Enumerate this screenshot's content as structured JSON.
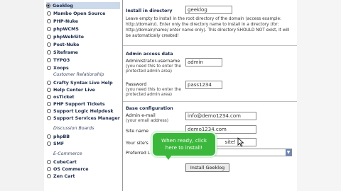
{
  "sidebar": {
    "groups": [
      {
        "items": [
          {
            "label": "Geeklog",
            "selected": true
          },
          {
            "label": "Mambo Open Source"
          },
          {
            "label": "PHP-Nuke"
          },
          {
            "label": "phpWCMS"
          },
          {
            "label": "phpWebSite"
          },
          {
            "label": "Post-Nuke"
          },
          {
            "label": "Siteframe"
          },
          {
            "label": "TYPO3"
          },
          {
            "label": "Xoops"
          }
        ]
      },
      {
        "heading": "Customer Relationship",
        "items": [
          {
            "label": "Crafty Syntax Live Help"
          },
          {
            "label": "Help Center Live"
          },
          {
            "label": "osTicket"
          },
          {
            "label": "PHP Support Tickets"
          },
          {
            "label": "Support Logic Helpdesk"
          },
          {
            "label": "Support Services Manager"
          }
        ]
      },
      {
        "heading": "Discussion Boards",
        "items": [
          {
            "label": "phpBB"
          },
          {
            "label": "SMF"
          }
        ]
      },
      {
        "heading": "E-Commerce",
        "items": [
          {
            "label": "CubeCart"
          },
          {
            "label": "OS Commerce"
          },
          {
            "label": "Zen Cart"
          }
        ]
      }
    ]
  },
  "form": {
    "install_dir": {
      "label": "Install in directory",
      "value": "geeklog",
      "hint": "Leave empty to install in the root directory of the domain (access example: http://domain/). Enter only the directory name to install in a directory (for: http://domain/name/ enter name only). This directory SHOULD NOT exist, it will be automatically created!"
    },
    "admin_section": "Admin access data",
    "admin_user": {
      "label": "Administrator-username",
      "sub": "(you need this to enter the protected admin area)",
      "value": "admin"
    },
    "admin_pass": {
      "label": "Password",
      "sub": "(you need this to enter the protected admin area)",
      "value": "pass1234"
    },
    "base_section": "Base configuration",
    "admin_email": {
      "label": "Admin e-mail",
      "sub": "(your email address)",
      "value": "info@demo1234.com"
    },
    "site_name": {
      "label": "Site name",
      "value": "demo1234.com"
    },
    "site_slogan": {
      "label": "Your site's",
      "value": "site!"
    },
    "pref_lang": {
      "label": "Preferred L"
    },
    "install_button": "Install Geeklog"
  },
  "tooltip": {
    "text": "When ready, click here to install!",
    "color": "#3bb83b"
  },
  "colors": {
    "selected_bg": "#ccd9ea",
    "heading": "#1c2b4a",
    "select_arrow": "#6f86b8"
  }
}
